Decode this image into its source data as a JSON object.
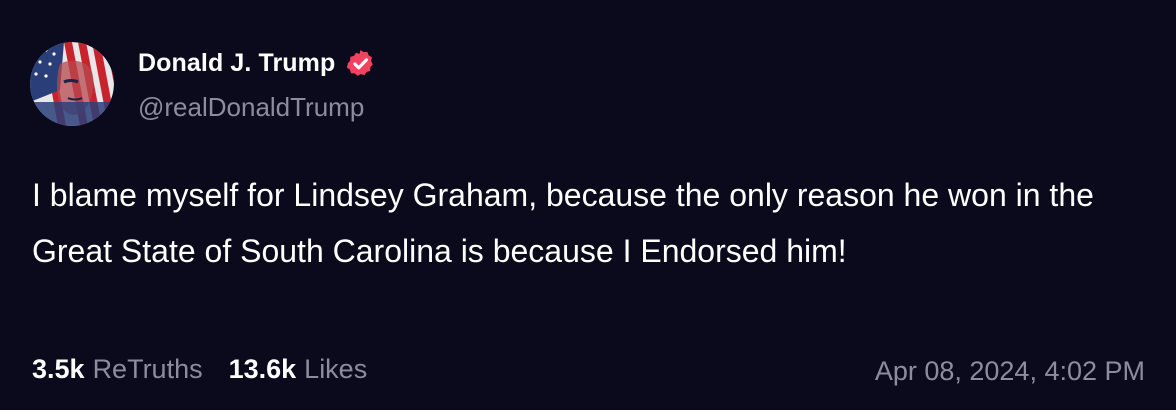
{
  "post": {
    "author": {
      "display_name": "Donald J. Trump",
      "handle": "@realDonaldTrump",
      "verified": true,
      "avatar_icon": "flag-portrait-avatar",
      "verified_icon": "verified-badge-icon"
    },
    "text": "I blame myself for Lindsey Graham, because the only reason he won in the Great State of South Carolina is because I Endorsed him!",
    "stats": {
      "retruths_count": "3.5k",
      "retruths_label": "ReTruths",
      "likes_count": "13.6k",
      "likes_label": "Likes"
    },
    "timestamp": "Apr 08, 2024, 4:02 PM"
  },
  "colors": {
    "background": "#0b0a1c",
    "primary_text": "#ffffff",
    "secondary_text": "#8d8c9e",
    "verified_badge": "#f0435f"
  }
}
